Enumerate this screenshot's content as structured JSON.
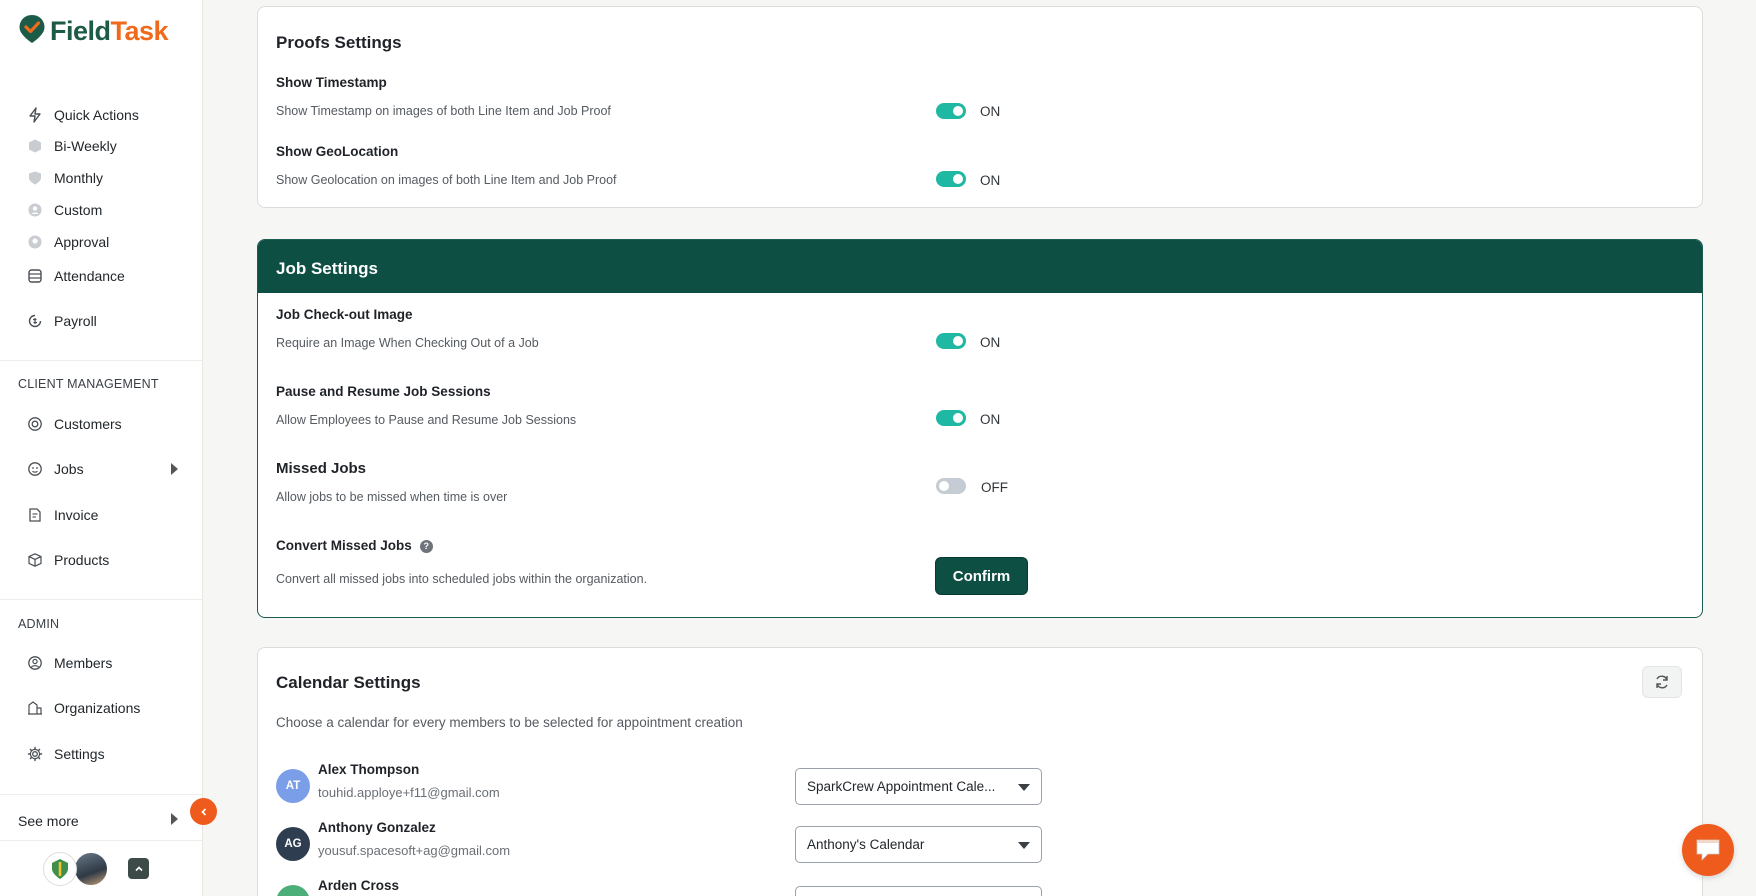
{
  "app": {
    "name_part1": "Field",
    "name_part2": "Task",
    "brand_colors": {
      "green": "#1c5b47",
      "orange": "#ef6a1c"
    }
  },
  "sidebar": {
    "items_top": [
      {
        "label": "Quick Actions",
        "icon": "lightning-icon"
      },
      {
        "label": "Bi-Weekly",
        "icon": "cube-icon"
      },
      {
        "label": "Monthly",
        "icon": "shield-icon"
      },
      {
        "label": "Custom",
        "icon": "user-circle-icon"
      },
      {
        "label": "Approval",
        "icon": "badge-icon"
      },
      {
        "label": "Attendance",
        "icon": "database-icon"
      },
      {
        "label": "Payroll",
        "icon": "payroll-icon"
      }
    ],
    "client_management_title": "CLIENT MANAGEMENT",
    "client_items": [
      {
        "label": "Customers",
        "icon": "target-icon"
      },
      {
        "label": "Jobs",
        "icon": "face-icon"
      },
      {
        "label": "Invoice",
        "icon": "invoice-icon"
      },
      {
        "label": "Products",
        "icon": "box-icon"
      }
    ],
    "admin_title": "ADMIN",
    "admin_items": [
      {
        "label": "Members",
        "icon": "user-icon"
      },
      {
        "label": "Organizations",
        "icon": "buildings-icon"
      },
      {
        "label": "Settings",
        "icon": "gear-icon"
      }
    ],
    "see_more": "See more"
  },
  "proofs": {
    "title": "Proofs Settings",
    "rows": [
      {
        "title": "Show Timestamp",
        "desc": "Show Timestamp on images of both Line Item and Job Proof",
        "state": "ON"
      },
      {
        "title": "Show GeoLocation",
        "desc": "Show Geolocation on images of both Line Item and Job Proof",
        "state": "ON"
      }
    ]
  },
  "job": {
    "title": "Job Settings",
    "rows": [
      {
        "title": "Job Check-out Image",
        "desc": "Require an Image When Checking Out of a Job",
        "state": "ON"
      },
      {
        "title": "Pause and Resume Job Sessions",
        "desc": "Allow Employees to Pause and Resume Job Sessions",
        "state": "ON"
      },
      {
        "title": "Missed Jobs",
        "desc": "Allow jobs to be missed when time is over",
        "state": "OFF"
      }
    ],
    "convert_title": "Convert Missed Jobs",
    "convert_help": "?",
    "convert_desc": "Convert all missed jobs into scheduled jobs within the organization.",
    "confirm_label": "Confirm"
  },
  "calendar": {
    "title": "Calendar Settings",
    "desc": "Choose a calendar for every members to be selected for appointment creation",
    "members": [
      {
        "initials": "AT",
        "name": "Alex Thompson",
        "email": "touhid.apploye+f11@gmail.com",
        "calendar": "SparkCrew Appointment Cale...",
        "avatar_color": "#7b9ee8"
      },
      {
        "initials": "AG",
        "name": "Anthony Gonzalez",
        "email": "yousuf.spacesoft+ag@gmail.com",
        "calendar": "Anthony's Calendar",
        "avatar_color": "#2e3d4f"
      },
      {
        "initials": "",
        "name": "Arden Cross",
        "email": "",
        "calendar": "",
        "avatar_color": "#4caf7a"
      }
    ]
  }
}
